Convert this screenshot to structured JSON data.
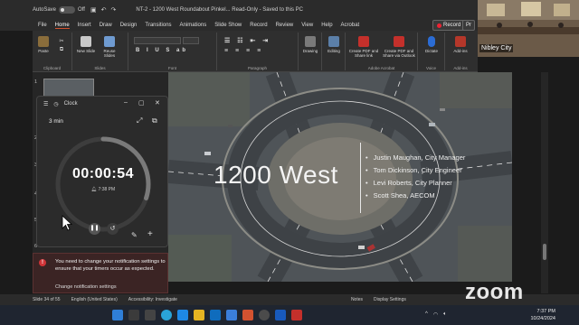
{
  "titlebar": {
    "autosave_label": "AutoSave",
    "autosave_state": "Off",
    "title": "NT-2 - 1200 West Roundabout Pinkel... Read-Only - Saved to this PC"
  },
  "record_button": "Record",
  "present_button": "Pr",
  "menu": {
    "tabs": [
      "File",
      "Home",
      "Insert",
      "Draw",
      "Design",
      "Transitions",
      "Animations",
      "Slide Show",
      "Record",
      "Review",
      "View",
      "Help",
      "Acrobat"
    ],
    "active": "Home"
  },
  "ribbon": {
    "paste": "Paste",
    "new_slide": "New Slide",
    "reuse_slides": "Reuse Slides",
    "clipboard": "Clipboard",
    "slides": "Slides",
    "font": "Font",
    "paragraph": "Paragraph",
    "drawing": "Drawing",
    "editing": "Editing",
    "create_pdf_share": "Create PDF and Share link",
    "create_pdf_outlook": "Create PDF and Share via Outlook",
    "adobe_acrobat": "Adobe Acrobat",
    "dictate": "Dictate",
    "voice": "Voice",
    "addins": "Add-ins",
    "addins_group": "Add-ins"
  },
  "thumbnails": {
    "first_number": "1",
    "numbers": [
      "2",
      "3",
      "4",
      "5",
      "6"
    ]
  },
  "slide": {
    "title": "1200 West",
    "bullets": [
      "Justin Maughan, City Manager",
      "Tom Dickinson, City Engineer",
      "Levi Roberts, City Planner",
      "Scott Shea, AECOM"
    ]
  },
  "clock": {
    "app_title": "Clock",
    "timer_label": "3 min",
    "time": "00:00:54",
    "end_time": "7:38 PM",
    "progress_fraction": 0.3
  },
  "notification": {
    "message": "You need to change your notification settings to ensure that your timers occur as expected.",
    "link": "Change notification settings"
  },
  "statusbar": {
    "slide_info": "Slide 34 of 55",
    "language": "English (United States)",
    "accessibility": "Accessibility: Investigate",
    "notes": "Notes",
    "display_settings": "Display Settings"
  },
  "taskbar": {
    "time": "7:37 PM",
    "date": "10/24/2024"
  },
  "zoom": {
    "participant_name": "Nibley City",
    "logo": "zoom"
  },
  "colors": {
    "accent": "#d35230",
    "record": "#e22233",
    "notification_bg": "#3b2424",
    "slide_bg": "#4b5054"
  }
}
